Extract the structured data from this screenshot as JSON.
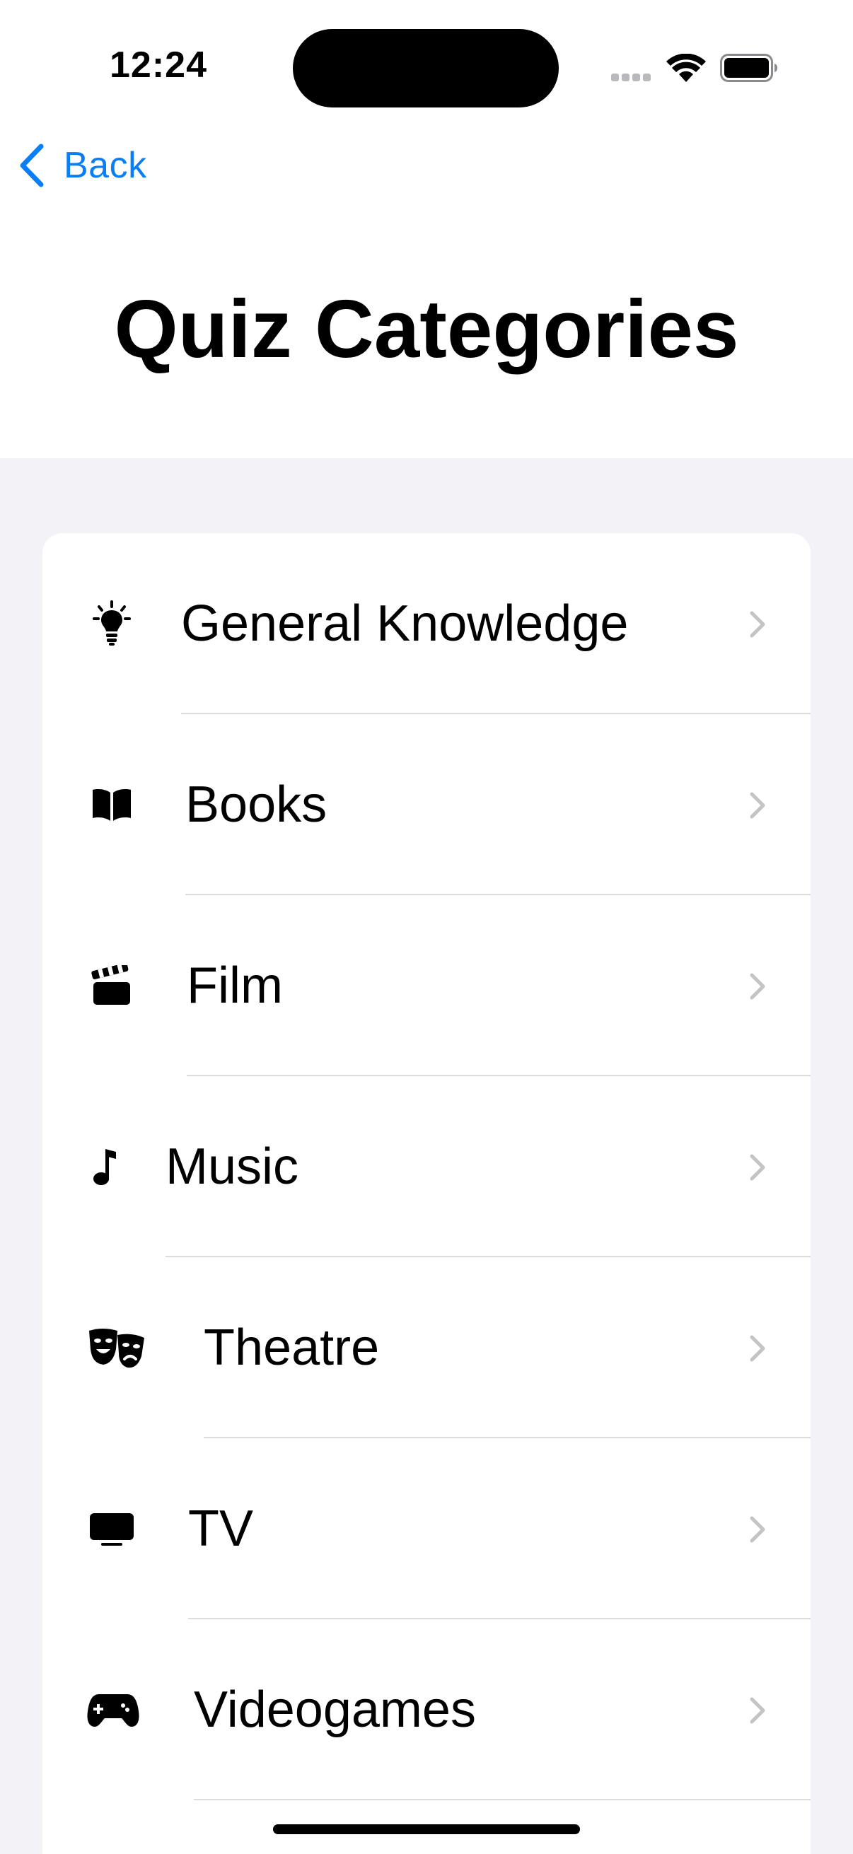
{
  "status_bar": {
    "time": "12:24",
    "icons": [
      "cellular-signal-icon",
      "wifi-icon",
      "battery-icon"
    ]
  },
  "nav": {
    "back_label": "Back",
    "title": "Quiz Categories"
  },
  "colors": {
    "accent": "#0a7ff5",
    "grouped_background": "#f2f2f7",
    "separator": "#dcdce0",
    "chevron": "#c4c4c7"
  },
  "categories": [
    {
      "label": "General Knowledge",
      "icon": "lightbulb-icon"
    },
    {
      "label": "Books",
      "icon": "book-icon"
    },
    {
      "label": "Film",
      "icon": "clapperboard-icon"
    },
    {
      "label": "Music",
      "icon": "music-note-icon"
    },
    {
      "label": "Theatre",
      "icon": "theatre-masks-icon"
    },
    {
      "label": "TV",
      "icon": "tv-icon"
    },
    {
      "label": "Videogames",
      "icon": "gamecontroller-icon"
    }
  ]
}
